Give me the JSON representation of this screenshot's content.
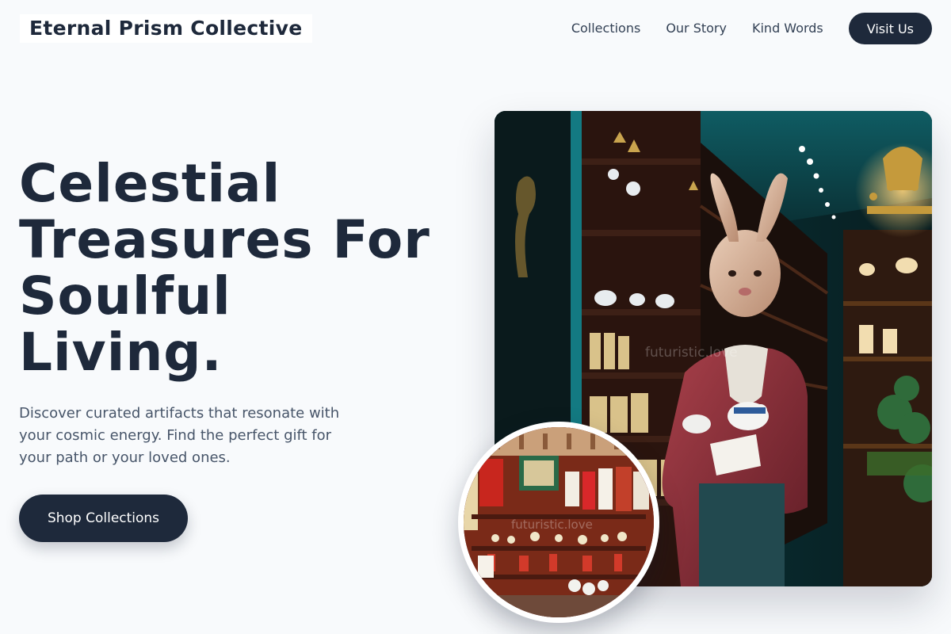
{
  "header": {
    "brand": "Eternal Prism Collective",
    "nav": {
      "collections": "Collections",
      "our_story": "Our Story",
      "kind_words": "Kind Words"
    },
    "cta": "Visit Us"
  },
  "hero": {
    "title": "Celestial Treasures For Soulful Living.",
    "description": "Discover curated artifacts that resonate with your cosmic energy. Find the perfect gift for your path or your loved ones.",
    "button": "Shop Collections"
  },
  "images": {
    "main_watermark": "futuristic.love",
    "circle_watermark": "futuristic.love"
  },
  "colors": {
    "background": "#f8fafc",
    "primary": "#1e293b",
    "text_muted": "#475569",
    "shop_teal": "#0f4a52"
  }
}
